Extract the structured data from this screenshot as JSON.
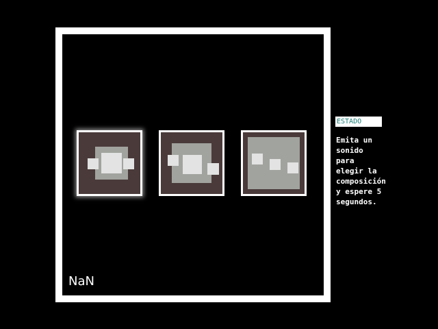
{
  "canvas": {
    "counter_text": "NaN"
  },
  "options": [
    {
      "label": "composition-1",
      "selected": true
    },
    {
      "label": "composition-2",
      "selected": false
    },
    {
      "label": "composition-3",
      "selected": false
    }
  ],
  "sidebar": {
    "status_label": "ESTADO",
    "instructions": "Emita un\nsonido\npara\nelegir la\ncomposición\ny espere 5\nsegundos."
  },
  "colors": {
    "background": "#000000",
    "frame": "#ffffff",
    "tile_bg": "#4a3a3a",
    "gray_block": "#a1a39e",
    "light_block": "#e2e3e2",
    "status_text": "#1b7f78"
  }
}
